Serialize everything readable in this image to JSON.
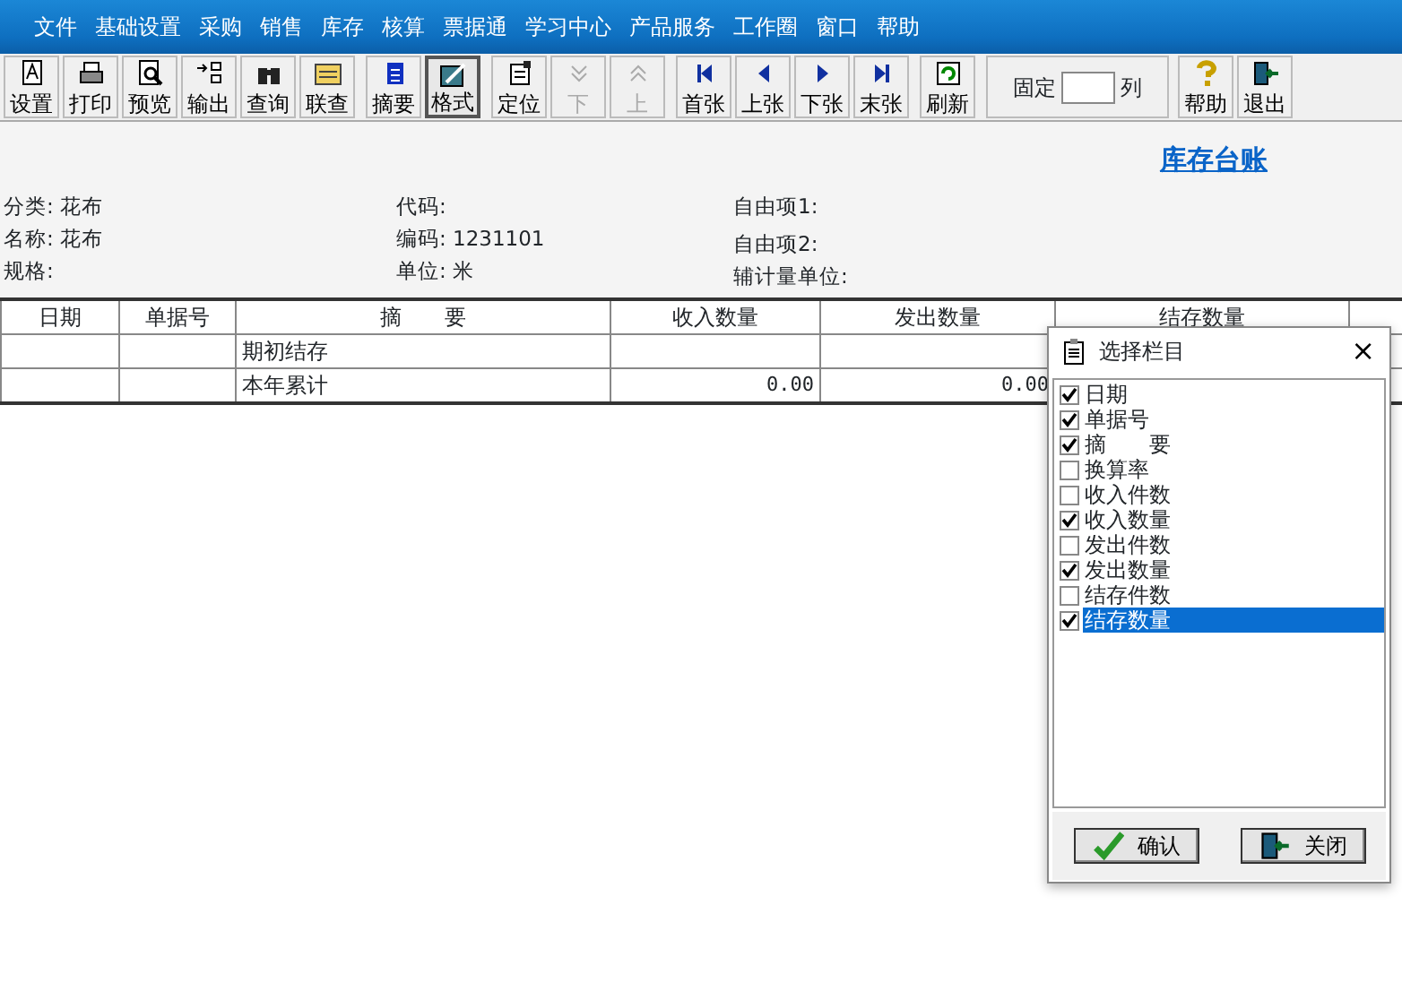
{
  "menu": [
    "文件",
    "基础设置",
    "采购",
    "销售",
    "库存",
    "核算",
    "票据通",
    "学习中心",
    "产品服务",
    "工作圈",
    "窗口",
    "帮助"
  ],
  "toolbar": [
    {
      "label": "设置",
      "disabled": false,
      "pressed": false
    },
    {
      "label": "打印",
      "disabled": false,
      "pressed": false
    },
    {
      "label": "预览",
      "disabled": false,
      "pressed": false
    },
    {
      "label": "输出",
      "disabled": false,
      "pressed": false
    },
    {
      "label": "查询",
      "disabled": false,
      "pressed": false
    },
    {
      "label": "联查",
      "disabled": false,
      "pressed": false
    },
    {
      "label": "摘要",
      "disabled": false,
      "pressed": false
    },
    {
      "label": "格式",
      "disabled": false,
      "pressed": true
    },
    {
      "label": "定位",
      "disabled": false,
      "pressed": false
    },
    {
      "label": "下",
      "disabled": true,
      "pressed": false
    },
    {
      "label": "上",
      "disabled": true,
      "pressed": false
    },
    {
      "label": "首张",
      "disabled": false,
      "pressed": false
    },
    {
      "label": "上张",
      "disabled": false,
      "pressed": false
    },
    {
      "label": "下张",
      "disabled": false,
      "pressed": false
    },
    {
      "label": "末张",
      "disabled": false,
      "pressed": false
    },
    {
      "label": "刷新",
      "disabled": false,
      "pressed": false
    }
  ],
  "fix_columns": {
    "label_before": "固定",
    "label_after": "列"
  },
  "toolbar_end": [
    "帮助",
    "退出"
  ],
  "report_title": "库存台账",
  "info": [
    [
      "分类: 花布",
      "代码:",
      "自由项1:"
    ],
    [
      "名称: 花布",
      "编码: 1231101",
      "自由项2:"
    ],
    [
      "规格:",
      "单位: 米",
      "辅计量单位:"
    ]
  ],
  "table": {
    "columns": [
      "日期",
      "单据号",
      "摘　　要",
      "收入数量",
      "发出数量",
      "结存数量"
    ],
    "rows": [
      [
        "",
        "",
        "期初结存",
        "",
        "",
        ""
      ],
      [
        "",
        "",
        "本年累计",
        "0.00",
        "0.00",
        ""
      ]
    ]
  },
  "dialog": {
    "title": "选择栏目",
    "close": "×",
    "items": [
      {
        "label": "日期",
        "checked": true,
        "selected": false
      },
      {
        "label": "单据号",
        "checked": true,
        "selected": false
      },
      {
        "label": "摘　　要",
        "checked": true,
        "selected": false
      },
      {
        "label": "换算率",
        "checked": false,
        "selected": false
      },
      {
        "label": "收入件数",
        "checked": false,
        "selected": false
      },
      {
        "label": "收入数量",
        "checked": true,
        "selected": false
      },
      {
        "label": "发出件数",
        "checked": false,
        "selected": false
      },
      {
        "label": "发出数量",
        "checked": true,
        "selected": false
      },
      {
        "label": "结存件数",
        "checked": false,
        "selected": false
      },
      {
        "label": "结存数量",
        "checked": true,
        "selected": true
      }
    ],
    "buttons": [
      "确认",
      "关闭"
    ]
  }
}
